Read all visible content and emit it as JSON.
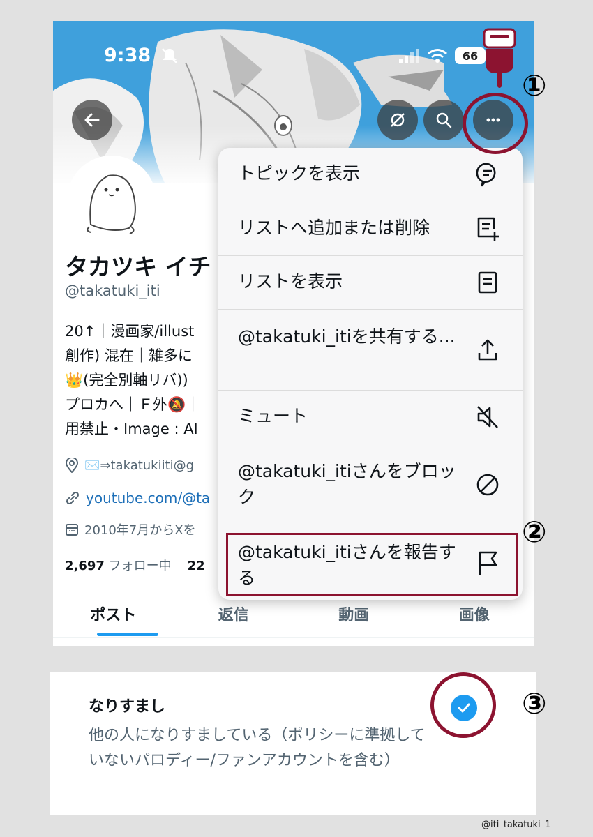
{
  "status_bar": {
    "time": "9:38",
    "battery": "66"
  },
  "profile": {
    "name": "タカツキ イチ",
    "handle": "@takatuki_iti",
    "bio_lines": [
      "20↑｜漫画家/illust",
      "創作) 混在｜雑多に",
      "👑(完全別軸リバ))",
      "プロカへ｜Ｆ外🔕｜",
      "用禁止・Image : AI"
    ],
    "location": "✉️⇒takatukiiti@g",
    "website": "youtube.com/@ta",
    "joined": "2010年7月からXを",
    "following_count": "2,697",
    "following_label": "フォロー中",
    "followers_count": "22"
  },
  "tabs": [
    "ポスト",
    "返信",
    "動画",
    "画像"
  ],
  "menu": {
    "items": [
      {
        "label": "トピックを表示",
        "icon": "topic-icon"
      },
      {
        "label": "リストへ追加または削除",
        "icon": "list-add-icon"
      },
      {
        "label": "リストを表示",
        "icon": "list-icon"
      },
      {
        "label": "@takatuki_itiを共有する...",
        "icon": "share-icon"
      },
      {
        "label": "ミュート",
        "icon": "mute-icon"
      },
      {
        "label": "@takatuki_itiさんをブロック",
        "icon": "block-icon"
      },
      {
        "label": "@takatuki_itiさんを報告する",
        "icon": "flag-icon"
      }
    ]
  },
  "annotations": {
    "step1": "①",
    "step2": "②",
    "step3": "③",
    "color": "#8c1330"
  },
  "report_option": {
    "title": "なりすまし",
    "description": "他の人になりすましている（ポリシーに準拠していないパロディー/ファンアカウントを含む）",
    "selected": true
  },
  "credit": "@iti_takatuki_1",
  "colors": {
    "accent": "#1d9bf0",
    "banner_sky": "#3fa0dc",
    "link": "#1d6fb8"
  }
}
